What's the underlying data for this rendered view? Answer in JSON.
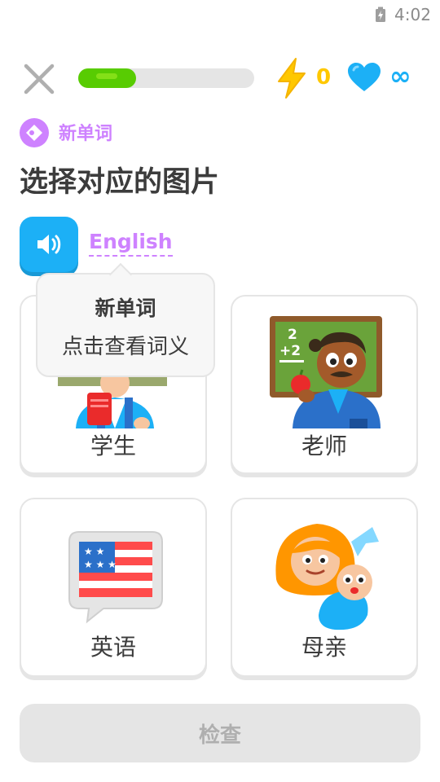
{
  "status_bar": {
    "time": "4:02",
    "battery_icon": "battery-charging-icon"
  },
  "top_bar": {
    "close_icon": "close-icon",
    "progress": 0.33,
    "progress_color": "#58cc02",
    "energy_icon": "lightning-icon",
    "energy_count": "0",
    "energy_color": "#ffc800",
    "hearts_icon": "heart-icon",
    "hearts_count": "∞",
    "hearts_color": "#1cb0f6"
  },
  "header": {
    "badge_icon": "new-word-icon",
    "badge_label": "新单词",
    "accent": "#ce82ff",
    "title": "选择对应的图片"
  },
  "audio": {
    "speaker_icon": "speaker-icon",
    "word": "English"
  },
  "tooltip": {
    "title": "新单词",
    "body": "点击查看词义"
  },
  "options": [
    {
      "label": "学生",
      "image": "student-illustration"
    },
    {
      "label": "老师",
      "image": "teacher-illustration"
    },
    {
      "label": "英语",
      "image": "us-flag-speech-bubble-illustration"
    },
    {
      "label": "母亲",
      "image": "mother-with-baby-illustration"
    }
  ],
  "footer": {
    "check_label": "检查"
  }
}
